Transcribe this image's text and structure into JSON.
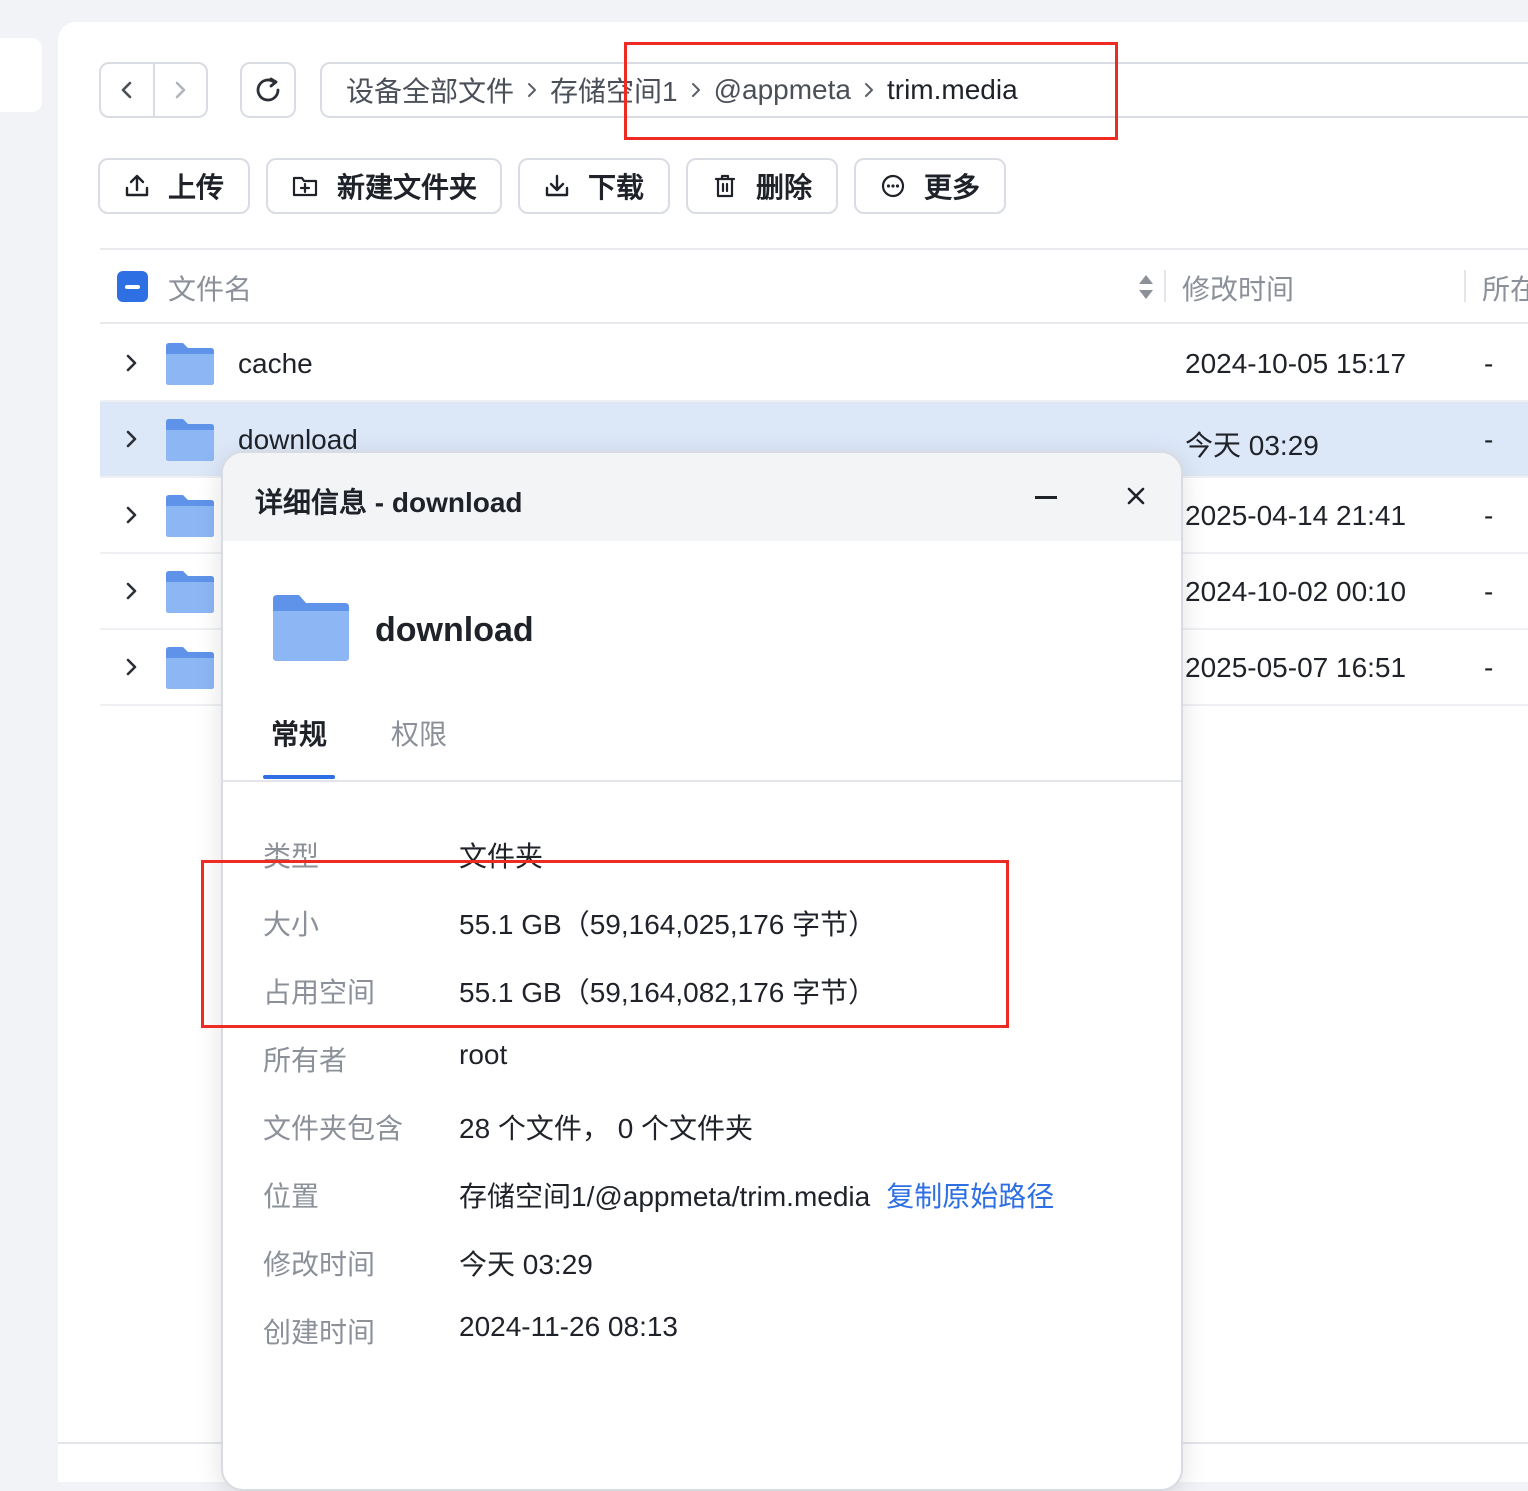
{
  "nav": {
    "back_icon": "chevron-left-icon",
    "forward_icon": "chevron-right-icon",
    "refresh_icon": "refresh-icon"
  },
  "breadcrumb": {
    "items": [
      "设备全部文件",
      "存储空间1",
      "@appmeta",
      "trim.media"
    ],
    "separator_icon": "chevron-right-icon"
  },
  "toolbar": {
    "upload_label": "上传",
    "new_folder_label": "新建文件夹",
    "download_label": "下载",
    "delete_label": "删除",
    "more_label": "更多"
  },
  "table": {
    "columns": {
      "name": "文件名",
      "modified": "修改时间",
      "owner": "所在"
    },
    "rows": [
      {
        "name": "cache",
        "modified": "2024-10-05 15:17",
        "owner": "-",
        "selected": false
      },
      {
        "name": "download",
        "modified": "今天 03:29",
        "owner": "-",
        "selected": true
      },
      {
        "name": "",
        "modified": "2025-04-14 21:41",
        "owner": "-",
        "selected": false
      },
      {
        "name": "",
        "modified": "2024-10-02 00:10",
        "owner": "-",
        "selected": false
      },
      {
        "name": "",
        "modified": "2025-05-07 16:51",
        "owner": "-",
        "selected": false
      }
    ]
  },
  "dialog": {
    "title": "详细信息 - download",
    "name": "download",
    "tabs": {
      "general": "常规",
      "permissions": "权限"
    },
    "properties": {
      "type_label": "类型",
      "type_value": "文件夹",
      "size_label": "大小",
      "size_value": "55.1 GB（59,164,025,176 字节）",
      "disk_label": "占用空间",
      "disk_value": "55.1 GB（59,164,082,176 字节）",
      "owner_label": "所有者",
      "owner_value": "root",
      "contains_label": "文件夹包含",
      "contains_value": "28 个文件， 0 个文件夹",
      "location_label": "位置",
      "location_value": "存储空间1/@appmeta/trim.media",
      "copy_path_label": "复制原始路径",
      "modified_label": "修改时间",
      "modified_value": "今天 03:29",
      "created_label": "创建时间",
      "created_value": "2024-11-26 08:13"
    }
  },
  "colors": {
    "accent": "#2f6fe4",
    "annotation": "#ee2b22",
    "selected_row": "#dce7f8",
    "folder": "#78a6f2"
  }
}
